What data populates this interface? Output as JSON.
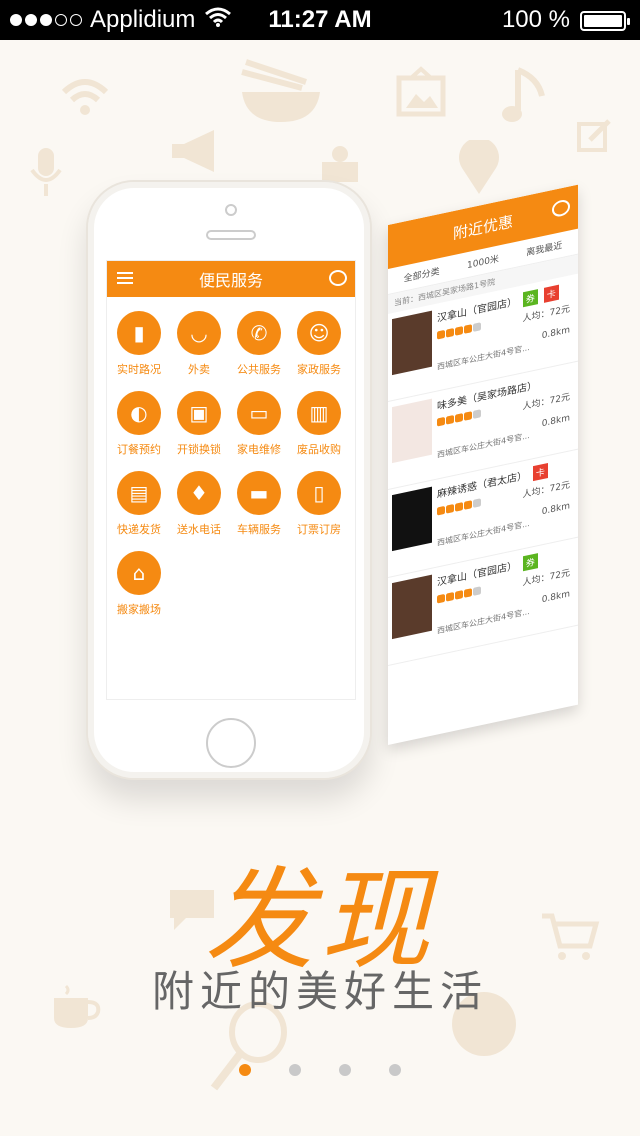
{
  "status_bar": {
    "carrier": "Applidium",
    "time": "11:27 AM",
    "battery": "100 %"
  },
  "phone_app": {
    "title": "便民服务",
    "services": [
      {
        "label": "实时路况",
        "icon": "traffic-light-icon"
      },
      {
        "label": "外卖",
        "icon": "basket-icon"
      },
      {
        "label": "公共服务",
        "icon": "phone-24-icon"
      },
      {
        "label": "家政服务",
        "icon": "housekeeper-icon"
      },
      {
        "label": "订餐预约",
        "icon": "headset-icon"
      },
      {
        "label": "开锁换锁",
        "icon": "lock-icon"
      },
      {
        "label": "家电维修",
        "icon": "monitor-icon"
      },
      {
        "label": "废品收购",
        "icon": "trash-icon"
      },
      {
        "label": "快递发货",
        "icon": "parcel-cart-icon"
      },
      {
        "label": "送水电话",
        "icon": "water-bottle-icon"
      },
      {
        "label": "车辆服务",
        "icon": "truck-icon"
      },
      {
        "label": "订票订房",
        "icon": "ticket-icon"
      },
      {
        "label": "搬家搬场",
        "icon": "moving-house-icon"
      }
    ]
  },
  "nearby_app": {
    "title": "附近优惠",
    "filters": [
      "全部分类",
      "1000米",
      "离我最近"
    ],
    "address": "当前：西城区吴家场路1号院",
    "items": [
      {
        "name": "汉拿山（官园店）",
        "tags": [
          "券",
          "卡"
        ],
        "price": "人均：72元",
        "distance": "0.8km",
        "address": "西城区车公庄大街4号官..."
      },
      {
        "name": "味多美（吴家场路店）",
        "tags": [],
        "price": "人均：72元",
        "distance": "0.8km",
        "address": "西城区车公庄大街4号官..."
      },
      {
        "name": "麻辣诱惑（君太店）",
        "tags": [
          "卡"
        ],
        "price": "人均：72元",
        "distance": "0.8km",
        "address": "西城区车公庄大街4号官..."
      },
      {
        "name": "汉拿山（官园店）",
        "tags": [
          "券"
        ],
        "price": "人均：72元",
        "distance": "0.8km",
        "address": "西城区车公庄大街4号官..."
      }
    ]
  },
  "headline": "发现",
  "subline": "附近的美好生活",
  "pager": {
    "count": 4,
    "active": 0
  },
  "colors": {
    "accent": "#f58a12",
    "tag_green": "#5bb520",
    "tag_red": "#e84030"
  }
}
